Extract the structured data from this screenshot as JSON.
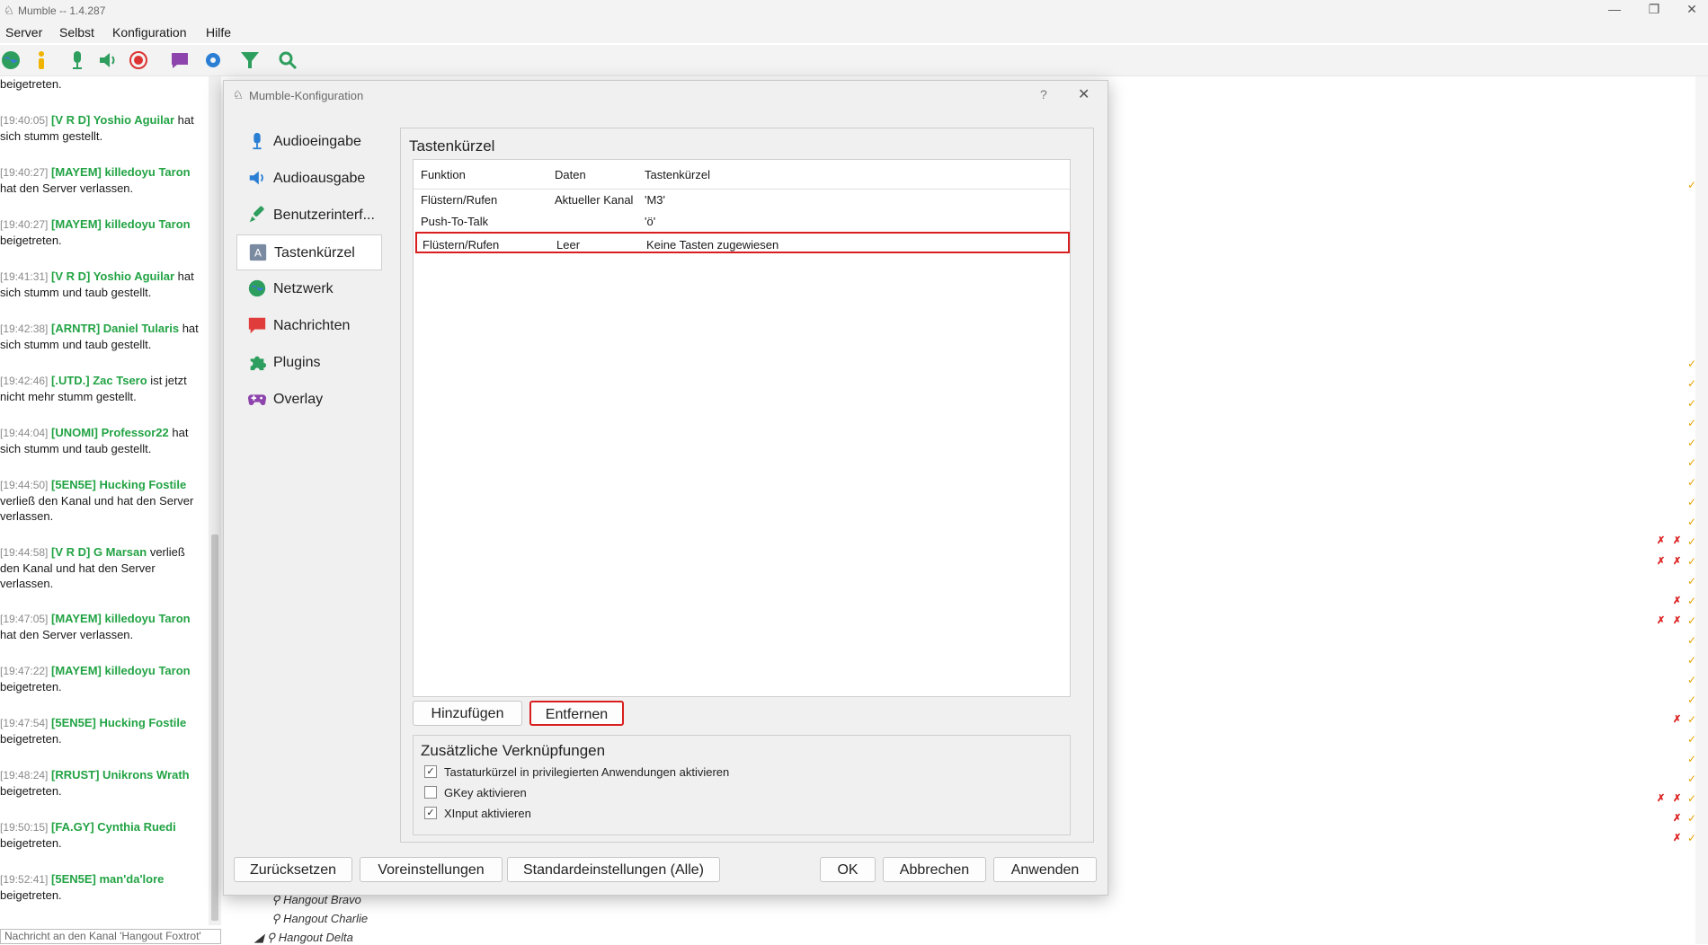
{
  "window": {
    "title": "Mumble -- 1.4.287"
  },
  "menu": [
    "Server",
    "Selbst",
    "Konfiguration",
    "Hilfe"
  ],
  "chat": {
    "top_fragment": "beigetreten.",
    "entries": [
      {
        "ts": "[19:40:05]",
        "name": "[V R D] Yoshio Aguilar",
        "text": " hat sich stumm gestellt."
      },
      {
        "ts": "[19:40:27]",
        "name": "[MAYEM] killedoyu Taron",
        "text": " hat den Server verlassen."
      },
      {
        "ts": "[19:40:27]",
        "name": "[MAYEM] killedoyu Taron",
        "text": " beigetreten."
      },
      {
        "ts": "[19:41:31]",
        "name": "[V R D] Yoshio Aguilar",
        "text": " hat sich stumm und taub gestellt."
      },
      {
        "ts": "[19:42:38]",
        "name": "[ARNTR] Daniel Tularis",
        "text": " hat sich stumm und taub gestellt."
      },
      {
        "ts": "[19:42:46]",
        "name": "[.UTD.] Zac Tsero",
        "text": " ist jetzt nicht mehr stumm gestellt."
      },
      {
        "ts": "[19:44:04]",
        "name": "[UNOMI] Professor22",
        "text": " hat sich stumm und taub gestellt."
      },
      {
        "ts": "[19:44:50]",
        "name": "[5EN5E] Hucking Fostile",
        "text": " verließ den Kanal und hat den Server verlassen."
      },
      {
        "ts": "[19:44:58]",
        "name": "[V R D] G Marsan",
        "text": " verließ den Kanal und hat den Server verlassen."
      },
      {
        "ts": "[19:47:05]",
        "name": "[MAYEM] killedoyu Taron",
        "text": " hat den Server verlassen."
      },
      {
        "ts": "[19:47:22]",
        "name": "[MAYEM] killedoyu Taron",
        "text": " beigetreten."
      },
      {
        "ts": "[19:47:54]",
        "name": "[5EN5E] Hucking Fostile",
        "text": " beigetreten."
      },
      {
        "ts": "[19:48:24]",
        "name": "[RRUST] Unikrons Wrath",
        "text": " beigetreten."
      },
      {
        "ts": "[19:50:15]",
        "name": "[FA.GY] Cynthia Ruedi",
        "text": " beigetreten."
      },
      {
        "ts": "[19:52:41]",
        "name": "[5EN5E] man'da'lore",
        "text": " beigetreten."
      }
    ],
    "input_placeholder": "Nachricht an den Kanal 'Hangout Foxtrot'"
  },
  "tree": {
    "items": [
      "Hangout Bravo",
      "Hangout Charlie",
      "Hangout Delta"
    ]
  },
  "dialog": {
    "title": "Mumble-Konfiguration",
    "help": "?",
    "close": "✕",
    "nav": [
      {
        "label": "Audioeingabe",
        "icon": "microphone-icon"
      },
      {
        "label": "Audioausgabe",
        "icon": "speaker-icon"
      },
      {
        "label": "Benutzerinterf...",
        "icon": "brush-icon"
      },
      {
        "label": "Tastenkürzel",
        "icon": "keyboard-icon",
        "active": true
      },
      {
        "label": "Netzwerk",
        "icon": "globe-icon"
      },
      {
        "label": "Nachrichten",
        "icon": "message-icon"
      },
      {
        "label": "Plugins",
        "icon": "puzzle-icon"
      },
      {
        "label": "Overlay",
        "icon": "gamepad-icon"
      }
    ],
    "section_title": "Tastenkürzel",
    "columns": [
      "Funktion",
      "Daten",
      "Tastenkürzel"
    ],
    "shortcuts": [
      {
        "function": "Flüstern/Rufen",
        "data": "Aktueller Kanal",
        "shortcut": "'M3'"
      },
      {
        "function": "Push-To-Talk",
        "data": "",
        "shortcut": "'ö'"
      },
      {
        "function": "Flüstern/Rufen",
        "data": "Leer",
        "shortcut": "Keine Tasten zugewiesen"
      }
    ],
    "add_label": "Hinzufügen",
    "remove_label": "Entfernen",
    "extra_title": "Zusätzliche Verknüpfungen",
    "options": [
      {
        "label": "Tastaturkürzel in privilegierten Anwendungen aktivieren",
        "checked": true
      },
      {
        "label": "GKey aktivieren",
        "checked": false
      },
      {
        "label": "XInput aktivieren",
        "checked": true
      }
    ],
    "footer": {
      "reset": "Zurücksetzen",
      "presets": "Voreinstellungen",
      "defaults_all": "Standardeinstellungen (Alle)",
      "ok": "OK",
      "cancel": "Abbrechen",
      "apply": "Anwenden"
    }
  }
}
